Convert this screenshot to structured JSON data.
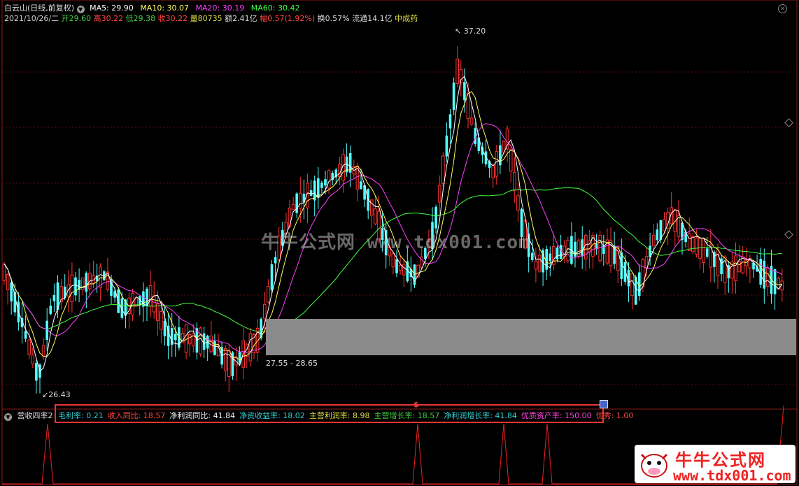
{
  "header": {
    "title": "白云山(日线,前复权)",
    "ma5": "MA5: 29.90",
    "ma10": "MA10: 30.07",
    "ma20": "MA20: 30.19",
    "ma60": "MA60: 30.42",
    "date": "2021/10/26/二",
    "open": "开29.60",
    "high": "高30.22",
    "low": "低29.38",
    "close": "收30.22",
    "volume": "量80735",
    "amount": "额2.41亿",
    "change": "幅0.57(1.92%)",
    "turnover": "换0.57%",
    "float": "流通14.1亿",
    "sector": "中成药"
  },
  "labels": {
    "high_price": "37.20",
    "low_price": "26.43",
    "range": "27.55 - 28.65"
  },
  "watermark": "牛牛公式网 www.tdx001.com",
  "indicator": {
    "name": "营收四率2",
    "items": [
      {
        "label": "毛利率: ",
        "value": "0.21",
        "color": "#3cc"
      },
      {
        "label": "收入同比: ",
        "value": "18.57",
        "color": "#f44"
      },
      {
        "label": "净利润同比: ",
        "value": "41.84",
        "color": "#eee"
      },
      {
        "label": "净资收益率: ",
        "value": "18.02",
        "color": "#3cc"
      },
      {
        "label": "主营利润率: ",
        "value": "8.98",
        "color": "#dd4"
      },
      {
        "label": "主营增长率: ",
        "value": "18.57",
        "color": "#4c4"
      },
      {
        "label": "净利润增长率: ",
        "value": "41.84",
        "color": "#3cc"
      },
      {
        "label": "优质资产率: ",
        "value": "150.00",
        "color": "#f4d"
      },
      {
        "label": "优秀: ",
        "value": "1.00",
        "color": "#f44"
      }
    ],
    "marker": "$"
  },
  "brand": {
    "name": "牛牛公式网",
    "url": "www.tdx001.com"
  },
  "colors": {
    "up": "#ff3232",
    "down": "#54ffff",
    "ma5": "#ffffff",
    "ma10": "#ffff60",
    "ma20": "#ff40ff",
    "ma60": "#40ff40"
  }
}
